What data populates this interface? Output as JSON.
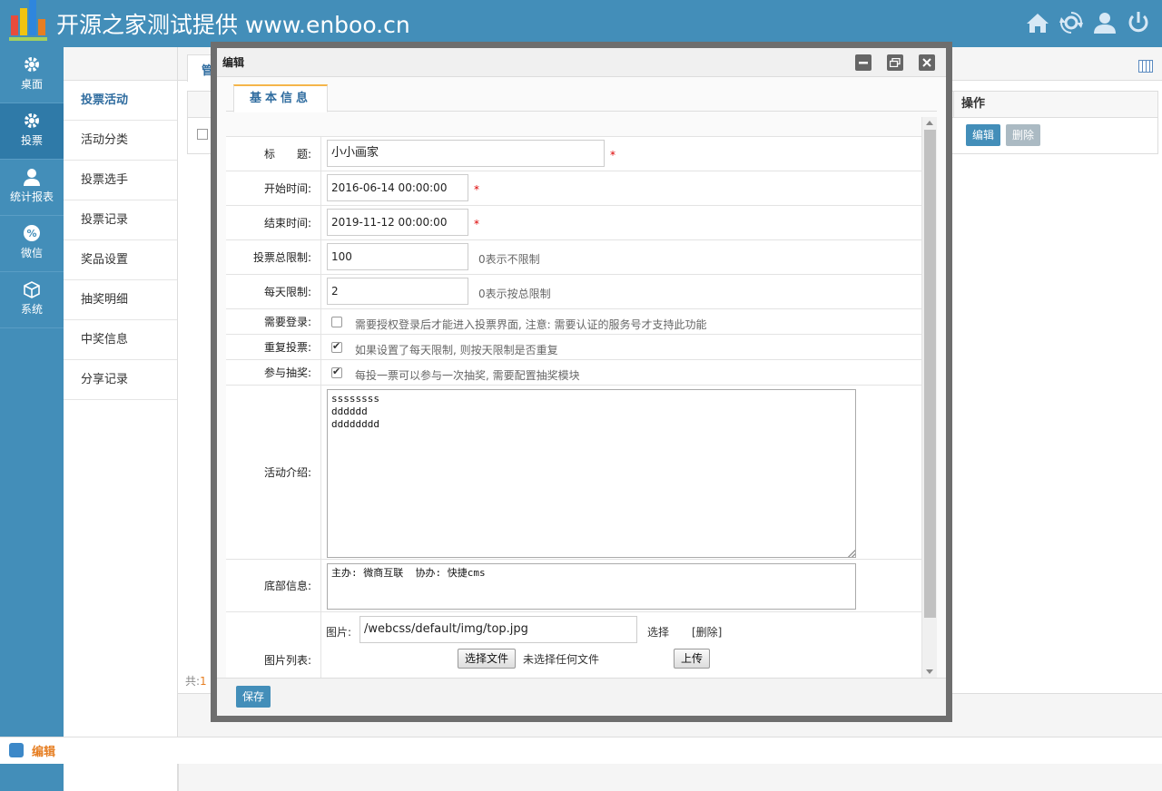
{
  "header": {
    "title": "开源之家测试提供 www.enboo.cn",
    "icons": [
      "home-icon",
      "refresh-icon",
      "user-icon",
      "power-icon"
    ]
  },
  "leftnav": {
    "items": [
      {
        "label": "桌面",
        "icon": "gear-icon"
      },
      {
        "label": "投票",
        "icon": "gear-icon",
        "active": true
      },
      {
        "label": "统计报表",
        "icon": "person-icon"
      },
      {
        "label": "微信",
        "icon": "percent-icon"
      },
      {
        "label": "系统",
        "icon": "box-icon"
      }
    ]
  },
  "subnav": {
    "items": [
      {
        "label": "投票活动",
        "active": true
      },
      {
        "label": "活动分类"
      },
      {
        "label": "投票选手"
      },
      {
        "label": "投票记录"
      },
      {
        "label": "奖品设置"
      },
      {
        "label": "抽奖明细"
      },
      {
        "label": "中奖信息"
      },
      {
        "label": "分享记录"
      }
    ]
  },
  "background": {
    "tab_label": "管",
    "op_header": "操作",
    "edit_label": "编辑",
    "delete_label": "删除",
    "total_prefix": "共:",
    "total_num": "1"
  },
  "bottombar": {
    "label": "编辑"
  },
  "modal": {
    "title": "编辑",
    "tab": "基本信息",
    "fields": {
      "title": {
        "label": "标　　题:",
        "value": "小小画家"
      },
      "start": {
        "label": "开始时间:",
        "value": "2016-06-14 00:00:00"
      },
      "end": {
        "label": "结束时间:",
        "value": "2019-11-12 00:00:00"
      },
      "total_limit": {
        "label": "投票总限制:",
        "value": "100",
        "hint": "0表示不限制"
      },
      "daily_limit": {
        "label": "每天限制:",
        "value": "2",
        "hint": "0表示按总限制"
      },
      "need_login": {
        "label": "需要登录:",
        "checked": false,
        "hint": "需要授权登录后才能进入投票界面, 注意: 需要认证的服务号才支持此功能"
      },
      "repeat_vote": {
        "label": "重复投票:",
        "checked": true,
        "hint": "如果设置了每天限制, 则按天限制是否重复"
      },
      "lottery": {
        "label": "参与抽奖:",
        "checked": true,
        "hint": "每投一票可以参与一次抽奖, 需要配置抽奖模块"
      },
      "intro": {
        "label": "活动介绍:",
        "value": "ssssssss\ndddddd\ndddddddd"
      },
      "footer_info": {
        "label": "底部信息:",
        "value": "主办: 微商互联  协办: 快捷cms"
      },
      "images": {
        "label": "图片列表:",
        "img_label": "图片:",
        "img_value": "/webcss/default/img/top.jpg",
        "select_link": "选择",
        "delete_link": "[删除]",
        "choose_file_btn": "选择文件",
        "no_file_text": "未选择任何文件",
        "upload_btn": "上传"
      }
    },
    "save_label": "保存",
    "required_mark": "*"
  }
}
